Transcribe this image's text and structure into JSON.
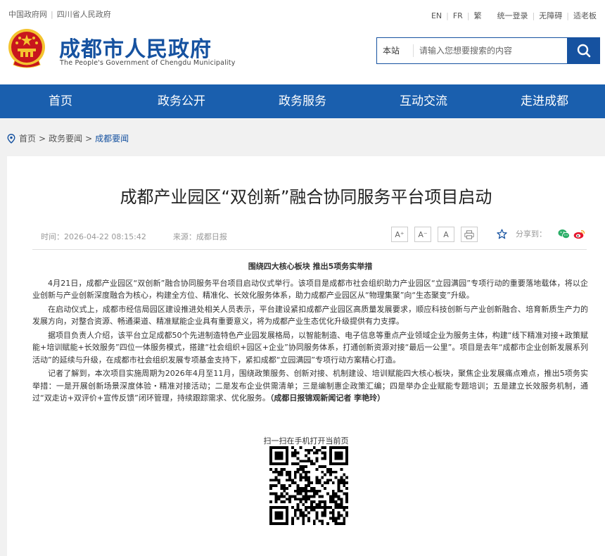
{
  "top_links": [
    "中国政府网",
    "四川省人民政府"
  ],
  "top_right": {
    "lang": [
      "EN",
      "FR",
      "繁"
    ],
    "links": [
      "统一登录",
      "无障碍",
      "适老板"
    ]
  },
  "site": {
    "title": "成都市人民政府",
    "subtitle": "The People's Government of Chengdu Municipality"
  },
  "search": {
    "scope": "本站",
    "placeholder": "请输入您想要搜索的内容",
    "value": ""
  },
  "nav": [
    "首页",
    "政务公开",
    "政务服务",
    "互动交流",
    "走进成都"
  ],
  "breadcrumb": {
    "items": [
      "首页",
      "政务要闻"
    ],
    "current": "成都要闻",
    "separator": ">"
  },
  "article": {
    "title": "成都产业园区“双创新”融合协同服务平台项目启动",
    "time": "时间：2026-04-22 08:15:42",
    "source": "来源：成都日报",
    "font_buttons": [
      "A⁺",
      "A⁻",
      "A"
    ],
    "share_label": "分享到：",
    "subheading": "围绕四大核心板块  推出5项务实举措",
    "paragraphs": [
      "4月21日，成都产业园区“双创新”融合协同服务平台项目启动仪式举行。该项目是成都市社会组织助力产业园区“立园满园”专项行动的重要落地载体，将以企业创新与产业创新深度融合为核心，构建全方位、精准化、长效化服务体系，助力成都产业园区从“物理集聚”向“生态聚变”升级。",
      "在启动仪式上，成都市经信局园区建设推进处相关人员表示，平台建设紧扣成都产业园区高质量发展要求，顺应科技创新与产业创新融合、培育新质生产力的发展方向，对整合资源、畅通渠道、精准赋能企业具有重要意义，将为成都产业生态优化升级提供有力支撑。",
      "据项目负责人介绍，该平台立足成都50个先进制造特色产业园发展格局，以智能制造、电子信息等重点产业领域企业为服务主体，构建“线下精准对接+政策赋能+培训赋能+长效服务”四位一体服务模式，搭建“社会组织+园区+企业”协同服务体系，打通创新资源对接“最后一公里”。项目是去年“成都市企业创新发展系列活动”的延续与升级，在成都市社会组织发展专项基金支持下，紧扣成都“立园满园”专项行动方案精心打造。",
      "记者了解到，本次项目实施周期为2026年4月至11月，围绕政策服务、创新对接、机制建设、培训赋能四大核心板块，聚焦企业发展痛点难点，推出5项务实举措：一是开展创新场景深度体验・精准对接活动；二是发布企业供需清单；三是编制惠企政策汇编；四是举办企业赋能专题培训；五是建立长效服务机制，通过“双走访+双评价+宣传反馈”闭环管理，持续跟踪需求、优化服务。"
    ],
    "byline": "（成都日报锦观新闻记者 李艳玲）",
    "qr_label": "扫一扫在手机打开当前页"
  },
  "colors": {
    "brand_blue": "#1652a0",
    "nav_blue": "#1a5fae",
    "emblem_red": "#c8161d",
    "emblem_gold": "#f4c430"
  },
  "icons": [
    "emblem-icon",
    "search-icon",
    "location-pin-icon",
    "print-icon",
    "star-icon",
    "wechat-icon",
    "weibo-icon",
    "qr-code"
  ]
}
